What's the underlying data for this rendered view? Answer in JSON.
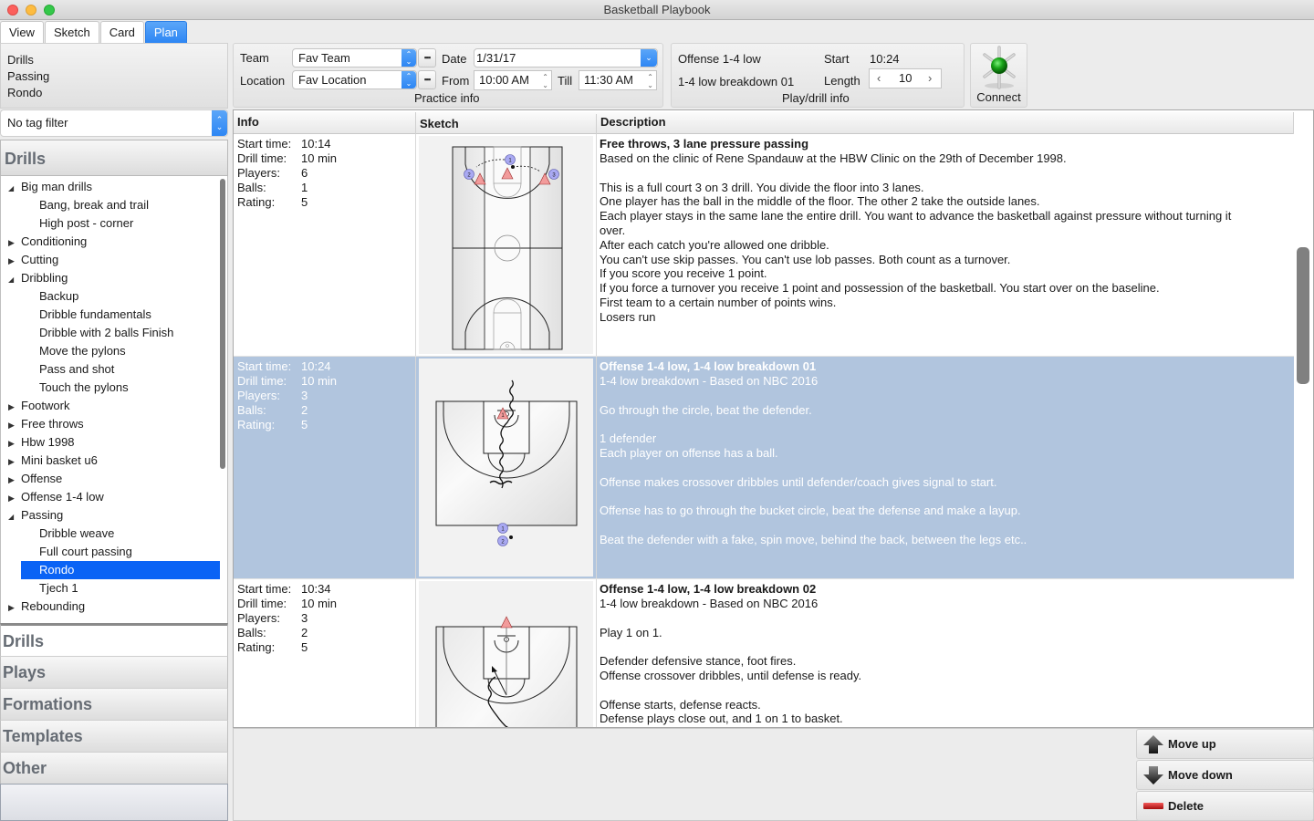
{
  "window": {
    "title": "Basketball Playbook"
  },
  "tabs": [
    {
      "label": "View",
      "active": false
    },
    {
      "label": "Sketch",
      "active": false
    },
    {
      "label": "Card",
      "active": false
    },
    {
      "label": "Plan",
      "active": true
    }
  ],
  "breadcrumb": [
    "Drills",
    "Passing",
    "Rondo"
  ],
  "tag_filter": {
    "value": "No tag filter"
  },
  "sidebar": {
    "section_title": "Drills",
    "tree": [
      {
        "label": "Big man drills",
        "level": 0,
        "expanded": true
      },
      {
        "label": "Bang, break and trail",
        "level": 1
      },
      {
        "label": "High post - corner",
        "level": 1
      },
      {
        "label": "Conditioning",
        "level": 0,
        "expanded": false
      },
      {
        "label": "Cutting",
        "level": 0,
        "expanded": false
      },
      {
        "label": "Dribbling",
        "level": 0,
        "expanded": true
      },
      {
        "label": "Backup",
        "level": 1
      },
      {
        "label": "Dribble fundamentals",
        "level": 1
      },
      {
        "label": "Dribble with 2 balls  Finish",
        "level": 1
      },
      {
        "label": "Move the pylons",
        "level": 1
      },
      {
        "label": "Pass and shot",
        "level": 1
      },
      {
        "label": "Touch the pylons",
        "level": 1
      },
      {
        "label": "Footwork",
        "level": 0,
        "expanded": false
      },
      {
        "label": "Free throws",
        "level": 0,
        "expanded": false
      },
      {
        "label": "Hbw 1998",
        "level": 0,
        "expanded": false
      },
      {
        "label": "Mini basket u6",
        "level": 0,
        "expanded": false
      },
      {
        "label": "Offense",
        "level": 0,
        "expanded": false
      },
      {
        "label": "Offense 1-4 low",
        "level": 0,
        "expanded": false
      },
      {
        "label": "Passing",
        "level": 0,
        "expanded": true
      },
      {
        "label": "Dribble weave",
        "level": 1
      },
      {
        "label": "Full court passing",
        "level": 1
      },
      {
        "label": "Rondo",
        "level": 1,
        "selected": true
      },
      {
        "label": "Tjech 1",
        "level": 1
      },
      {
        "label": "Rebounding",
        "level": 0,
        "expanded": false
      }
    ],
    "categories": [
      "Drills",
      "Plays",
      "Formations",
      "Templates",
      "Other"
    ]
  },
  "practice_info": {
    "caption": "Practice info",
    "team_label": "Team",
    "team_value": "Fav Team",
    "location_label": "Location",
    "location_value": "Fav Location",
    "date_label": "Date",
    "date_value": "1/31/17",
    "from_label": "From",
    "from_value": "10:00 AM",
    "till_label": "Till",
    "till_value": "11:30 AM",
    "more_button": "▪▪▪"
  },
  "play_info": {
    "caption": "Play/drill info",
    "name": "Offense 1-4 low",
    "sub": "1-4 low breakdown 01",
    "start_label": "Start",
    "start_value": "10:24",
    "length_label": "Length",
    "length_value": "10"
  },
  "connect": {
    "label": "Connect"
  },
  "table": {
    "headers": [
      "Info",
      "Sketch",
      "Description"
    ],
    "info_keys": [
      "Start time:",
      "Drill time:",
      "Players:",
      "Balls:",
      "Rating:"
    ],
    "rows": [
      {
        "start": "10:14",
        "drill_time": "10 min",
        "players": "6",
        "balls": "1",
        "rating": "5",
        "title": "Free throws, 3 lane pressure passing",
        "lines": [
          "Based on the clinic of Rene Spandauw at the HBW Clinic on the 29th of December 1998.",
          "",
          "This is a full court 3 on 3 drill. You divide the floor into 3 lanes.",
          "One player has the ball in the middle of the floor. The other 2 take the outside lanes.",
          "Each player stays in the same lane the entire drill. You want to advance the basketball against pressure without turning it",
          "over.",
          "After each catch you're allowed one dribble.",
          "You can't use skip passes. You can't use lob passes. Both count as a turnover.",
          "If you score you receive 1 point.",
          "If you force a turnover you receive 1 point and possession of the basketball. You start over on the baseline.",
          "First team to a certain number of points wins.",
          "Losers run"
        ]
      },
      {
        "start": "10:24",
        "drill_time": "10 min",
        "players": "3",
        "balls": "2",
        "rating": "5",
        "selected": true,
        "title": "Offense 1-4 low, 1-4 low breakdown 01",
        "lines": [
          "1-4 low breakdown - Based on NBC 2016",
          "",
          "Go through the circle, beat the defender.",
          "",
          "1 defender",
          "Each player on offense has a ball.",
          "",
          "Offense makes crossover dribbles until defender/coach gives signal to start.",
          "",
          "Offense has to go through the bucket circle, beat the defense and make a layup.",
          "",
          "Beat the defender with a fake, spin move, behind the back, between the legs etc.."
        ]
      },
      {
        "start": "10:34",
        "drill_time": "10 min",
        "players": "3",
        "balls": "2",
        "rating": "5",
        "title": "Offense 1-4 low, 1-4 low breakdown 02",
        "lines": [
          "1-4 low breakdown - Based on NBC 2016",
          "",
          "Play 1 on 1.",
          "",
          "Defender defensive stance, foot fires.",
          "Offense crossover dribbles, until defense is ready.",
          "",
          "Offense starts, defense reacts.",
          "Defense plays close out, and 1 on 1 to basket."
        ]
      }
    ]
  },
  "actions": {
    "move_up": "Move up",
    "move_down": "Move down",
    "delete": "Delete"
  }
}
